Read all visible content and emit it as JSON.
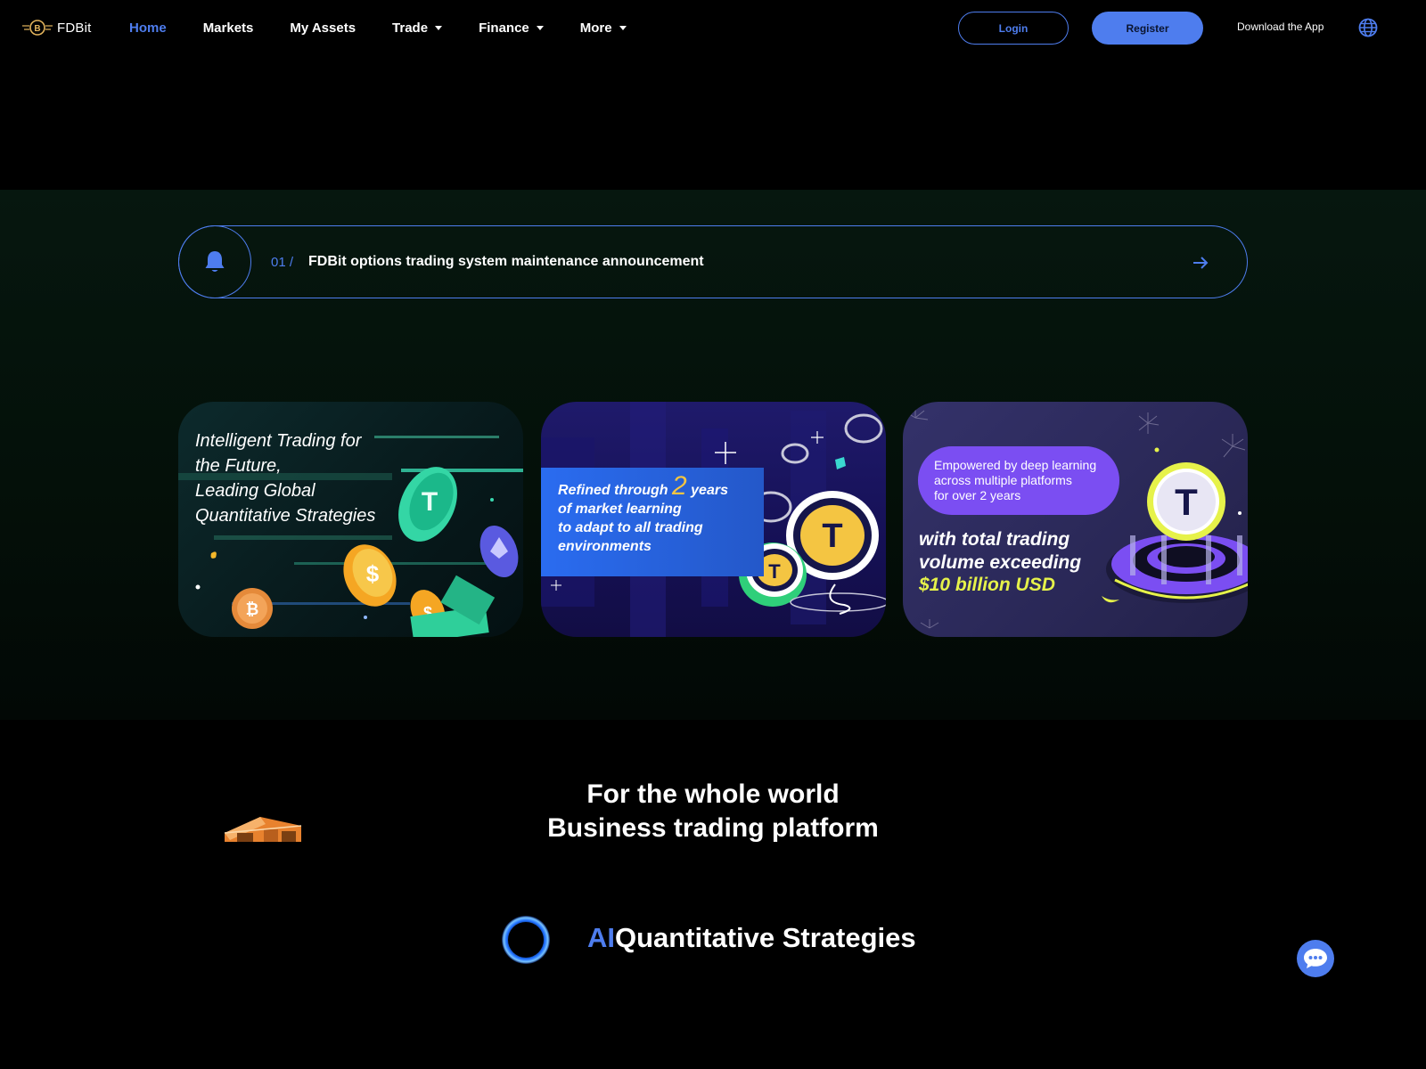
{
  "header": {
    "logo_text": "FDBit",
    "nav": [
      "Home",
      "Markets",
      "My Assets",
      "Trade",
      "Finance",
      "More"
    ],
    "active_nav": "Home",
    "login_label": "Login",
    "register_label": "Register",
    "download_label": "Download the App"
  },
  "announcement": {
    "index": "01 /",
    "text": "FDBit options trading system maintenance announcement"
  },
  "cards": {
    "card1": {
      "text": "Intelligent Trading for\nthe Future,\nLeading Global\nQuantitative Strategies"
    },
    "card2": {
      "line1_pre": "Refined through",
      "line1_num": "2",
      "line1_post": "years",
      "line2": "of market learning",
      "line3": "to adapt to all trading",
      "line4": "environments"
    },
    "card3": {
      "bubble": "Empowered by deep learning\nacross multiple platforms\nfor over 2 years",
      "main": "with total trading\nvolume exceeding",
      "accent": "$10 billion USD"
    }
  },
  "section_world": {
    "line1": "For the whole world",
    "line2": "Business trading platform"
  },
  "section_ai": {
    "prefix": "AI",
    "rest": "Quantitative Strategies"
  },
  "colors": {
    "accent": "#4e7dee",
    "background": "#000000",
    "hero_band": "#06170f",
    "card2_highlight": "#f4c542",
    "card3_accent": "#e6f24a",
    "card3_bubble": "#7b4ef2"
  },
  "icons": [
    "logo-icon",
    "caret-down-icon",
    "globe-icon",
    "bell-icon",
    "arrow-right-icon",
    "box-icon",
    "orb-icon",
    "chat-icon"
  ]
}
